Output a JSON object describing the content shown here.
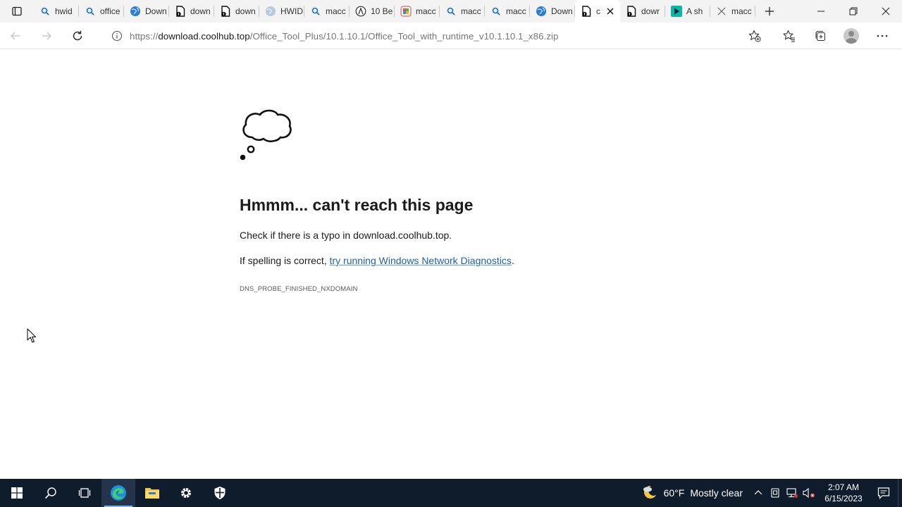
{
  "browser": {
    "tabs": [
      {
        "label": "hwid",
        "icon": "search"
      },
      {
        "label": "office",
        "icon": "search"
      },
      {
        "label": "Down",
        "icon": "globe"
      },
      {
        "label": "down",
        "icon": "download"
      },
      {
        "label": "down",
        "icon": "download"
      },
      {
        "label": "HWID",
        "icon": "globe-gray"
      },
      {
        "label": "macc",
        "icon": "search"
      },
      {
        "label": "10 Be",
        "icon": "circle-a"
      },
      {
        "label": "macc",
        "icon": "colorful"
      },
      {
        "label": "macc",
        "icon": "search"
      },
      {
        "label": "macc",
        "icon": "search"
      },
      {
        "label": "Down",
        "icon": "globe"
      },
      {
        "label": "c",
        "icon": "download",
        "active": true
      },
      {
        "label": "dowr",
        "icon": "download"
      },
      {
        "label": "A sh",
        "icon": "play"
      },
      {
        "label": "macc",
        "icon": "x"
      }
    ],
    "address": {
      "scheme": "https://",
      "host": "download.coolhub.top",
      "path": "/Office_Tool_Plus/10.1.10.1/Office_Tool_with_runtime_v10.1.10.1_x86.zip"
    }
  },
  "error_page": {
    "title": "Hmmm... can't reach this page",
    "line1": "Check if there is a typo in download.coolhub.top.",
    "line2_prefix": "If spelling is correct, ",
    "line2_link": "try running Windows Network Diagnostics",
    "line2_suffix": ".",
    "code": "DNS_PROBE_FINISHED_NXDOMAIN"
  },
  "taskbar": {
    "weather_temp": "60°F",
    "weather_condition": "Mostly clear",
    "time": "2:07 AM",
    "date": "6/15/2023"
  },
  "colors": {
    "link": "#1b63a8",
    "taskbar_bg": "#0f1c2c",
    "tabstrip_bg": "#f3f3f3",
    "accent": "#76b9ed"
  }
}
